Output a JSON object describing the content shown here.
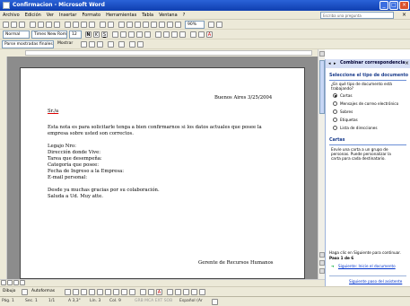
{
  "window": {
    "title": "Confirmacion - Microsoft Word"
  },
  "menu": [
    "Archivo",
    "Edición",
    "Ver",
    "Insertar",
    "Formato",
    "Herramientas",
    "Tabla",
    "Ventana",
    "?"
  ],
  "help_placeholder": "Escriba una pregunta",
  "formatting": {
    "style": "Normal",
    "font": "Times New Roman",
    "size": "12",
    "zoom": "90%"
  },
  "mailmerge_bar": {
    "label": "Parse mostradas finales",
    "show": "Mostrar"
  },
  "document": {
    "date": "Buenos Aires 3/25/2004",
    "salutation": "Sr./a",
    "body1": "Esta nota es para solicitarle tenga a bien confirmarnos si los datos actuales que posee la",
    "body2": "empresa sobre usted son correctos.",
    "f1": "Legajo Nro:",
    "f2": "Dirección donde Vive:",
    "f3": "Tarea que desempeña:",
    "f4": "Categoría que posee:",
    "f5": "Fecha de Ingreso a la Empresa:",
    "f6": "E-mail personal:",
    "thanks": "Desde ya muchas gracias por su colaboración.",
    "closing": "Saluda a Ud. Muy atte.",
    "signature": "Gerente de Recursos Humanos"
  },
  "taskpane": {
    "title": "Combinar correspondencia",
    "section1": "Seleccione el tipo de documento",
    "q1": "¿En qué tipo de documento está",
    "q2": "trabajando?",
    "options": [
      "Cartas",
      "Mensajes de correo electrónico",
      "Sobres",
      "Etiquetas",
      "Lista de direcciones"
    ],
    "section2": "Cartas",
    "desc1": "Envíe una carta a un grupo de",
    "desc2": "personas. Puede personalizar la",
    "desc3": "carta para cada destinatario.",
    "next_hint": "Haga clic en Siguiente para continuar.",
    "step": "Paso 1 de 6",
    "next_link": "Siguiente: Inicie el documento",
    "next_link2": "Siguiente paso del asistente"
  },
  "drawbar": {
    "draw": "Dibujo",
    "autoshapes": "Autoformas"
  },
  "status": {
    "page": "Pág. 1",
    "sec": "Sec. 1",
    "pages": "1/1",
    "at": "A 3,3\"",
    "line": "Lín. 3",
    "col": "Col. 9",
    "flags": "GRB MCA EXT SOB",
    "lang": "Español (Ar"
  }
}
